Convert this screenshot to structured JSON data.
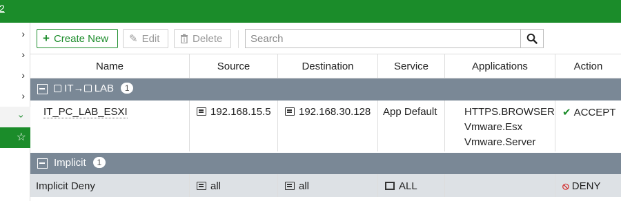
{
  "topbar": {
    "partial_text": "2"
  },
  "toolbar": {
    "create_label": "Create New",
    "edit_label": "Edit",
    "delete_label": "Delete",
    "search_placeholder": "Search"
  },
  "columns": [
    "Name",
    "Source",
    "Destination",
    "Service",
    "Applications",
    "Action"
  ],
  "groups": [
    {
      "label_pre": "IT",
      "arrow": "→",
      "label_post": "LAB",
      "count": "1"
    },
    {
      "label": "Implicit",
      "count": "1"
    }
  ],
  "rows": [
    {
      "name": "IT_PC_LAB_ESXI",
      "source": "192.168.15.5",
      "destination": "192.168.30.128",
      "service": "App Default",
      "applications": [
        "HTTPS.BROWSER",
        "Vmware.Esx",
        "Vmware.Server"
      ],
      "action": "ACCEPT"
    },
    {
      "name": "Implicit Deny",
      "source": "all",
      "destination": "all",
      "service": "ALL",
      "applications": [],
      "action": "DENY"
    }
  ],
  "colors": {
    "accent": "#1b8c2a",
    "group_bg": "#7a8896",
    "deny": "#d32f2f"
  }
}
